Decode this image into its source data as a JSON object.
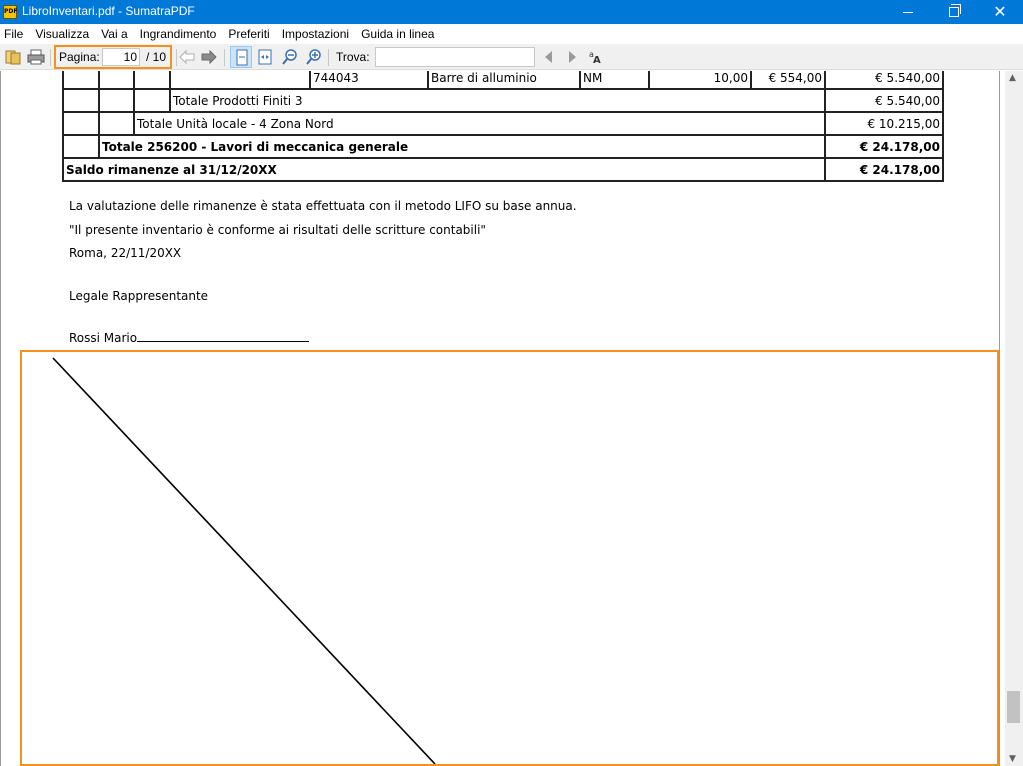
{
  "window": {
    "title": "LibroInventari.pdf - SumatraPDF",
    "app_icon_text": "PDF"
  },
  "menu": [
    "File",
    "Visualizza",
    "Vai a",
    "Ingrandimento",
    "Preferiti",
    "Impostazioni",
    "Guida in linea"
  ],
  "toolbar": {
    "page_label": "Pagina:",
    "page_current": "10",
    "page_total": "/ 10",
    "find_label": "Trova:",
    "find_value": ""
  },
  "table": {
    "row0": {
      "code": "744043",
      "desc": "Barre di alluminio",
      "um": "NM",
      "qty": "10,00",
      "price": "€ 554,00",
      "total": "€ 5.540,00"
    },
    "row1": {
      "label": "Totale Prodotti Finiti 3",
      "total": "€ 5.540,00"
    },
    "row2": {
      "label": "Totale Unità locale - 4 Zona Nord",
      "total": "€ 10.215,00"
    },
    "row3": {
      "label": "Totale 256200 - Lavori di meccanica generale",
      "total": "€ 24.178,00"
    },
    "row4": {
      "label": "Saldo rimanenze al 31/12/20XX",
      "total": "€ 24.178,00"
    }
  },
  "text": {
    "valuation": "La valutazione delle rimanenze è stata effettuata con il metodo LIFO su base annua.",
    "conformity": "\"Il presente inventario è conforme ai risultati delle scritture contabili\"",
    "place_date": "Roma, 22/11/20XX",
    "legal_rep": "Legale Rappresentante",
    "signatory": "Rossi Mario"
  },
  "colors": {
    "titlebar": "#0078d7",
    "highlight": "#f5921e"
  }
}
